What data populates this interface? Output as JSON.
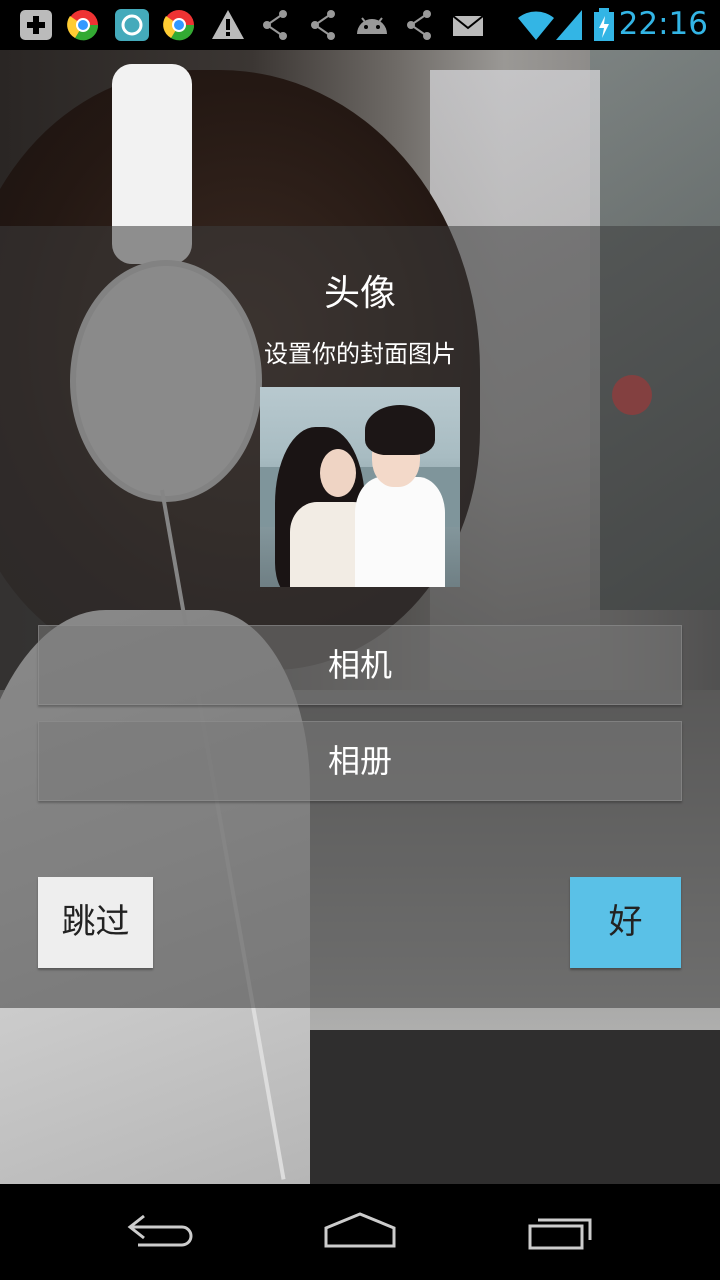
{
  "status_bar": {
    "time": "22:16",
    "icons": [
      "add-icon",
      "chrome-icon",
      "qq-icon",
      "chrome-icon",
      "warning-icon",
      "share-icon",
      "share-icon",
      "android-icon",
      "share-icon",
      "mail-icon",
      "wifi-icon",
      "signal-icon",
      "battery-charging-icon"
    ],
    "accent_color": "#33b5e5"
  },
  "dialog": {
    "title": "头像",
    "subtitle": "设置你的封面图片",
    "camera_label": "相机",
    "album_label": "相册",
    "skip_label": "跳过",
    "ok_label": "好",
    "ok_color": "#5ac1e7"
  },
  "nav_bar": {
    "icons": [
      "back-icon",
      "home-icon",
      "recent-apps-icon"
    ]
  }
}
